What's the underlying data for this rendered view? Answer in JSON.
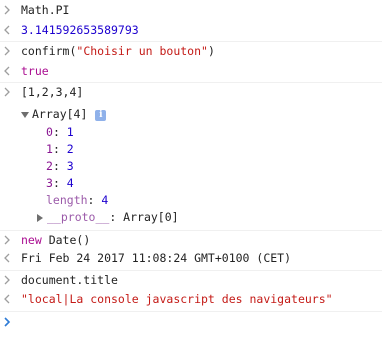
{
  "console": {
    "entries": [
      {
        "input": "Math.PI",
        "result": "3.141592653589793"
      },
      {
        "input_fn": "confirm(",
        "input_arg": "\"Choisir un bouton\"",
        "input_close": ")",
        "result": "true"
      },
      {
        "input": "[1,2,3,4]",
        "array_label": "Array[4]",
        "info_badge": "i",
        "items": [
          {
            "key": "0",
            "value": "1"
          },
          {
            "key": "1",
            "value": "2"
          },
          {
            "key": "2",
            "value": "3"
          },
          {
            "key": "3",
            "value": "4"
          }
        ],
        "length_key": "length",
        "length_value": "4",
        "proto_key": "__proto__",
        "proto_value": "Array[0]"
      },
      {
        "input_kw": "new",
        "input_rest": " Date()",
        "result": "Fri Feb 24 2017 11:08:24 GMT+0100 (CET)"
      },
      {
        "input": "document.title",
        "result": "\"local|La console javascript des navigateurs\""
      }
    ],
    "prompt_value": ""
  },
  "colors": {
    "number": "#1c00cf",
    "string": "#c41a16",
    "keyword": "#aa0d91",
    "property": "#881391",
    "prompt_active": "#2e7bd6"
  },
  "icons": {
    "input_marker": "chevron-right-icon",
    "output_marker": "chevron-left-icon",
    "expanded": "triangle-down-icon",
    "collapsed": "triangle-right-icon",
    "info": "info-icon"
  }
}
